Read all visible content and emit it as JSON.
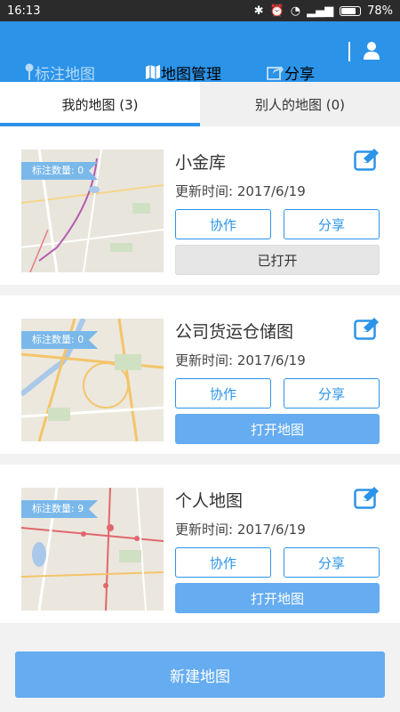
{
  "statusbar": {
    "time": "16:13",
    "battery": "78%"
  },
  "topbar": {
    "nav_mark": "标注地图",
    "nav_manage": "地图管理",
    "nav_share": "分享"
  },
  "tabs": {
    "mine": "我的地图 (3)",
    "others": "别人的地图 (0)"
  },
  "maps": [
    {
      "name": "小金库",
      "updated": "更新时间: 2017/6/19",
      "badge": "标注数量: 0",
      "collab": "协作",
      "share": "分享",
      "action": "已打开"
    },
    {
      "name": "公司货运仓储图",
      "updated": "更新时间: 2017/6/19",
      "badge": "标注数量: 0",
      "collab": "协作",
      "share": "分享",
      "action": "打开地图"
    },
    {
      "name": "个人地图",
      "updated": "更新时间: 2017/6/19",
      "badge": "标注数量: 9",
      "collab": "协作",
      "share": "分享",
      "action": "打开地图"
    }
  ],
  "footer": {
    "new_map": "新建地图"
  },
  "colors": {
    "primary": "#2b93e8",
    "button_fill": "#65acf0",
    "badge": "#7ab8ea"
  }
}
